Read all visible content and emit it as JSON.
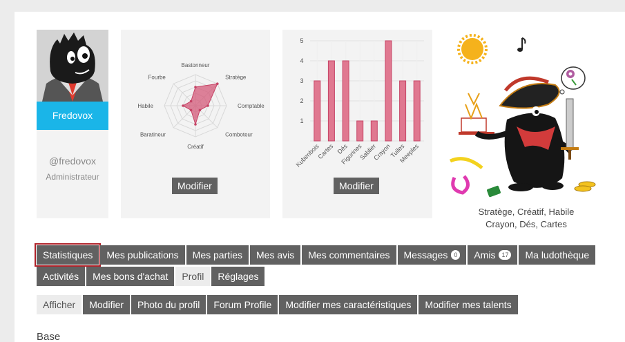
{
  "user": {
    "name": "Fredovox",
    "handle": "@fredovox",
    "role": "Administrateur"
  },
  "buttons": {
    "modify_radar": "Modifier",
    "modify_bars": "Modifier"
  },
  "chart_data": [
    {
      "type": "radar",
      "axes": [
        "Bastonneur",
        "Stratège",
        "Comptable",
        "Comboteur",
        "Créatif",
        "Baratineur",
        "Habile",
        "Fourbe"
      ],
      "values": [
        3,
        5,
        2,
        1,
        3,
        1,
        2,
        1
      ],
      "rmax": 5,
      "color": "#d45a7a"
    },
    {
      "type": "bar",
      "categories": [
        "Kubenbois",
        "Cartes",
        "Dés",
        "Figurines",
        "Sablier",
        "Crayon",
        "Tuiles",
        "Meeples"
      ],
      "values": [
        3,
        4,
        4,
        1,
        1,
        5,
        3,
        3
      ],
      "ylim": [
        0,
        5
      ],
      "yticks": [
        1,
        2,
        3,
        4,
        5
      ],
      "color": "#e07890"
    }
  ],
  "talents": {
    "line1": "Stratège, Créatif, Habile",
    "line2": "Crayon, Dés, Cartes"
  },
  "tabs_main": [
    {
      "label": "Statistiques",
      "active": true
    },
    {
      "label": "Mes publications"
    },
    {
      "label": "Mes parties"
    },
    {
      "label": "Mes avis"
    },
    {
      "label": "Mes commentaires"
    },
    {
      "label": "Messages",
      "badge": "0"
    },
    {
      "label": "Amis",
      "badge": "17"
    },
    {
      "label": "Ma ludothèque"
    }
  ],
  "tabs_main2": [
    {
      "label": "Activités"
    },
    {
      "label": "Mes bons d'achat"
    },
    {
      "label": "Profil",
      "light": true
    },
    {
      "label": "Réglages"
    }
  ],
  "tabs_profile": [
    {
      "label": "Afficher",
      "light": true
    },
    {
      "label": "Modifier"
    },
    {
      "label": "Photo du profil"
    },
    {
      "label": "Forum Profile"
    },
    {
      "label": "Modifier mes caractéristiques"
    },
    {
      "label": "Modifier mes talents"
    }
  ],
  "section_title": "Base"
}
